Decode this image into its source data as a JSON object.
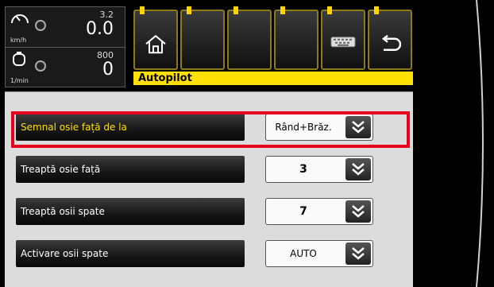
{
  "gauges": {
    "speed": {
      "unit": "km/h",
      "small": "3.2",
      "big": "0.0"
    },
    "rpm": {
      "unit": "1/min",
      "small": "800",
      "big": "0"
    }
  },
  "softkeys": [
    {
      "name": "home",
      "icon": "home-icon"
    },
    {
      "name": "empty-1",
      "icon": ""
    },
    {
      "name": "empty-2",
      "icon": ""
    },
    {
      "name": "empty-3",
      "icon": ""
    },
    {
      "name": "keyboard",
      "icon": "keyboard-icon"
    },
    {
      "name": "back",
      "icon": "back-arrow-icon"
    }
  ],
  "title": "Autopilot",
  "rows": [
    {
      "label": "Semnal osie față de la",
      "value": "Rând+Brăz.",
      "active": true
    },
    {
      "label": "Treaptă osie față",
      "value": "3",
      "active": false
    },
    {
      "label": "Treaptă osii spate",
      "value": "7",
      "active": false
    },
    {
      "label": "Activare osii spate",
      "value": "AUTO",
      "active": false
    }
  ],
  "colors": {
    "highlight": "#e8001c",
    "accent": "#ffe000"
  }
}
